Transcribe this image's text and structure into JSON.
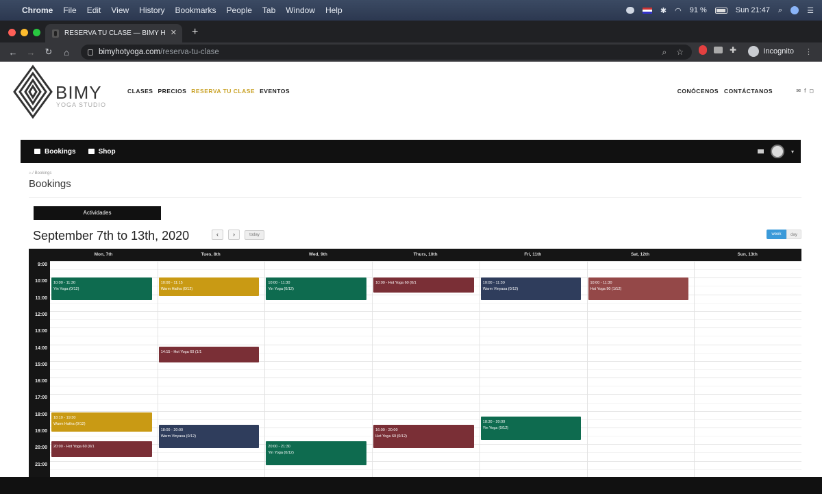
{
  "menubar": {
    "app": "Chrome",
    "items": [
      "File",
      "Edit",
      "View",
      "History",
      "Bookmarks",
      "People",
      "Tab",
      "Window",
      "Help"
    ],
    "battery": "91 %",
    "clock": "Sun 21:47"
  },
  "browser": {
    "tab_title": "RESERVA TU CLASE — BIMY H",
    "url_host": "bimyhotyoga.com",
    "url_path": "/reserva-tu-clase",
    "profile": "Incognito"
  },
  "site": {
    "logo": "BIMY",
    "logo_sub": "YOGA STUDIO",
    "nav_left": [
      "CLASES",
      "PRECIOS",
      "RESERVA TU CLASE",
      "EVENTOS"
    ],
    "nav_right": [
      "CONÓCENOS",
      "CONTÁCTANOS"
    ]
  },
  "member_bar": {
    "bookings": "Bookings",
    "shop": "Shop"
  },
  "page": {
    "breadcrumb": "Bookings",
    "title": "Bookings",
    "activities_button": "Actividades",
    "date_range": "September 7th to 13th, 2020",
    "prev": "‹",
    "next": "›",
    "today": "today",
    "view_week": "week",
    "view_day": "day"
  },
  "calendar": {
    "days": [
      "Mon, 7th",
      "Tues, 8th",
      "Wed, 9th",
      "Thurs, 10th",
      "Fri, 11th",
      "Sat, 12th",
      "Sun, 13th"
    ],
    "hours": [
      "9:00",
      "10:00",
      "11:00",
      "12:00",
      "13:00",
      "14:00",
      "15:00",
      "16:00",
      "17:00",
      "18:00",
      "19:00",
      "20:00",
      "21:00"
    ],
    "colors": {
      "green": "#0e6b4f",
      "mustard": "#c99a14",
      "maroon": "#7a2f36",
      "navy": "#2f3d5c",
      "rose": "#944848"
    },
    "events": [
      {
        "day": 0,
        "start": 10.0,
        "end": 11.33,
        "color": "green",
        "time": "10:00 - 11:30",
        "title": "Yin Yoga (0/12)"
      },
      {
        "day": 0,
        "start": 18.1,
        "end": 19.25,
        "color": "mustard",
        "time": "18:10 - 19:30",
        "title": "Warm Hatha (0/12)"
      },
      {
        "day": 0,
        "start": 19.83,
        "end": 20.75,
        "color": "maroon",
        "time": "",
        "title": "20:00 - Hot Yoga 60 (0/1"
      },
      {
        "day": 1,
        "start": 10.0,
        "end": 11.1,
        "color": "mustard",
        "time": "10:00 - 11:15",
        "title": "Warm Hatha (0/12)"
      },
      {
        "day": 1,
        "start": 14.15,
        "end": 15.1,
        "color": "maroon",
        "time": "",
        "title": "14:15 - Hot Yoga 60 (1/1"
      },
      {
        "day": 1,
        "start": 18.83,
        "end": 20.25,
        "color": "navy",
        "time": "18:00 - 20:00",
        "title": "Warm Vinyasa (0/12)"
      },
      {
        "day": 2,
        "start": 10.0,
        "end": 11.33,
        "color": "green",
        "time": "10:00 - 11:30",
        "title": "Yin Yoga (0/12)"
      },
      {
        "day": 2,
        "start": 19.83,
        "end": 21.25,
        "color": "green",
        "time": "20:00 - 21:30",
        "title": "Yin Yoga (0/12)"
      },
      {
        "day": 3,
        "start": 10.0,
        "end": 10.9,
        "color": "maroon",
        "time": "",
        "title": "10:00 - Hot Yoga 60 (0/1"
      },
      {
        "day": 3,
        "start": 18.83,
        "end": 20.25,
        "color": "maroon",
        "time": "16:00 - 20:00",
        "title": "Hot Yoga 60 (0/12)"
      },
      {
        "day": 4,
        "start": 10.0,
        "end": 11.33,
        "color": "navy",
        "time": "10:00 - 11:30",
        "title": "Warm Vinyasa (0/12)"
      },
      {
        "day": 4,
        "start": 18.33,
        "end": 19.75,
        "color": "green",
        "time": "18:30 - 20:00",
        "title": "Yin Yoga (0/12)"
      },
      {
        "day": 5,
        "start": 10.0,
        "end": 11.33,
        "color": "rose",
        "time": "10:00 - 11:30",
        "title": "Hot Yoga 90 (1/12)"
      }
    ]
  }
}
